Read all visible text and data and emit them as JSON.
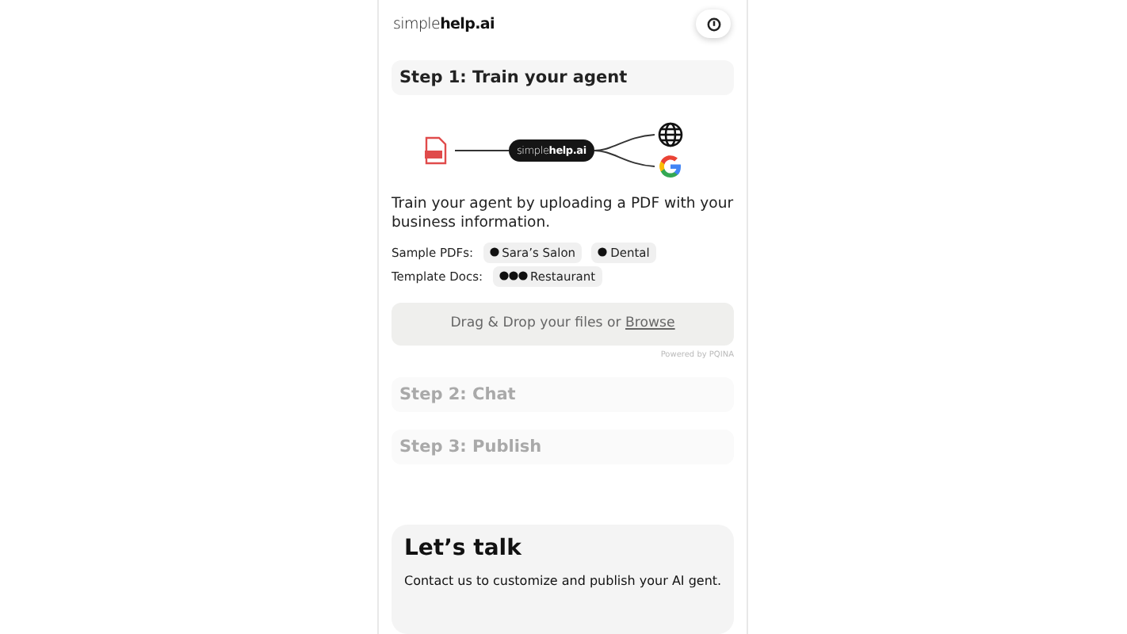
{
  "header": {
    "logo": "simple**help.ai**"
  },
  "steps": [
    {
      "title": "Step 1: Train your agent",
      "disabled": false
    },
    {
      "title": "Step 2: Chat",
      "disabled": true
    },
    {
      "title": "Step 3: Publish",
      "disabled": true
    }
  ],
  "diagram": {
    "hub": "simple**help.ai**"
  },
  "intro": "Train your agent by uploading a PDF with your business information.",
  "sample_rows": [
    {
      "label": "Sample PDFs:",
      "chips": [
        {
          "label": "Sara’s Salon",
          "kind": "dot"
        },
        {
          "label": "Dental",
          "kind": "dot"
        }
      ]
    },
    {
      "label": "Template Docs:",
      "chips": [
        {
          "label": "Restaurant",
          "kind": "dots"
        }
      ]
    }
  ],
  "dropzone": {
    "text": "Drag & Drop your files or ",
    "link": "Browse",
    "credit": "Powered by PQINA"
  },
  "contact": {
    "title": "Let’s talk",
    "text": "Contact us to customize and publish your AI gent."
  }
}
